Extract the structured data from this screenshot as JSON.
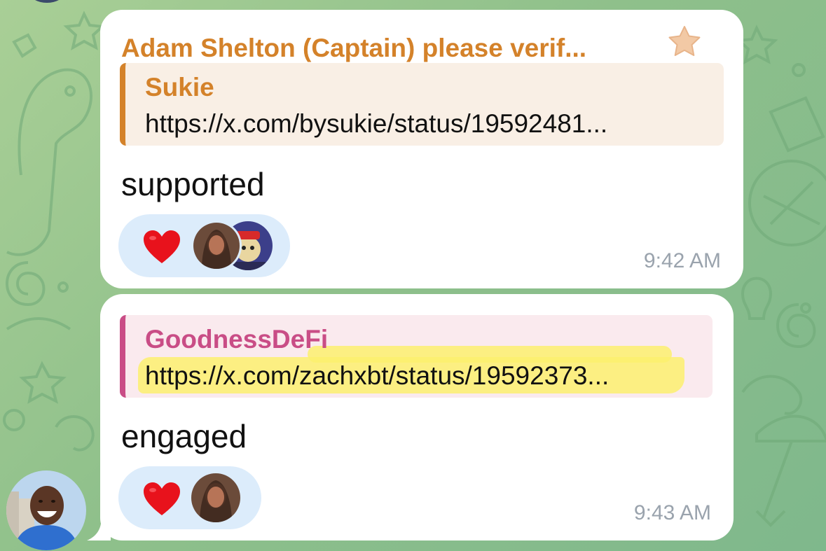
{
  "chat": {
    "messages": [
      {
        "sender": "Adam Shelton (Captain) please verif...",
        "sender_badge_icon": "star-icon",
        "reply": {
          "name": "Sukie",
          "link": "https://x.com/bysukie/status/19592481..."
        },
        "text": "supported",
        "reactions": {
          "emoji": "heart-icon",
          "avatars": 2
        },
        "time": "9:42 AM"
      },
      {
        "reply": {
          "name": "GoodnessDeFi",
          "link": "https://x.com/zachxbt/status/19592373..."
        },
        "text": "engaged",
        "reactions": {
          "emoji": "heart-icon",
          "avatars": 1
        },
        "time": "9:43 AM"
      }
    ]
  },
  "colors": {
    "sender_name": "#d4822a",
    "reply_accent_1": "#d4822a",
    "reply_accent_2": "#c94d86",
    "reaction_bg": "#dcecfb",
    "highlight": "#fbf06f",
    "timestamp": "#9aa3ad"
  }
}
